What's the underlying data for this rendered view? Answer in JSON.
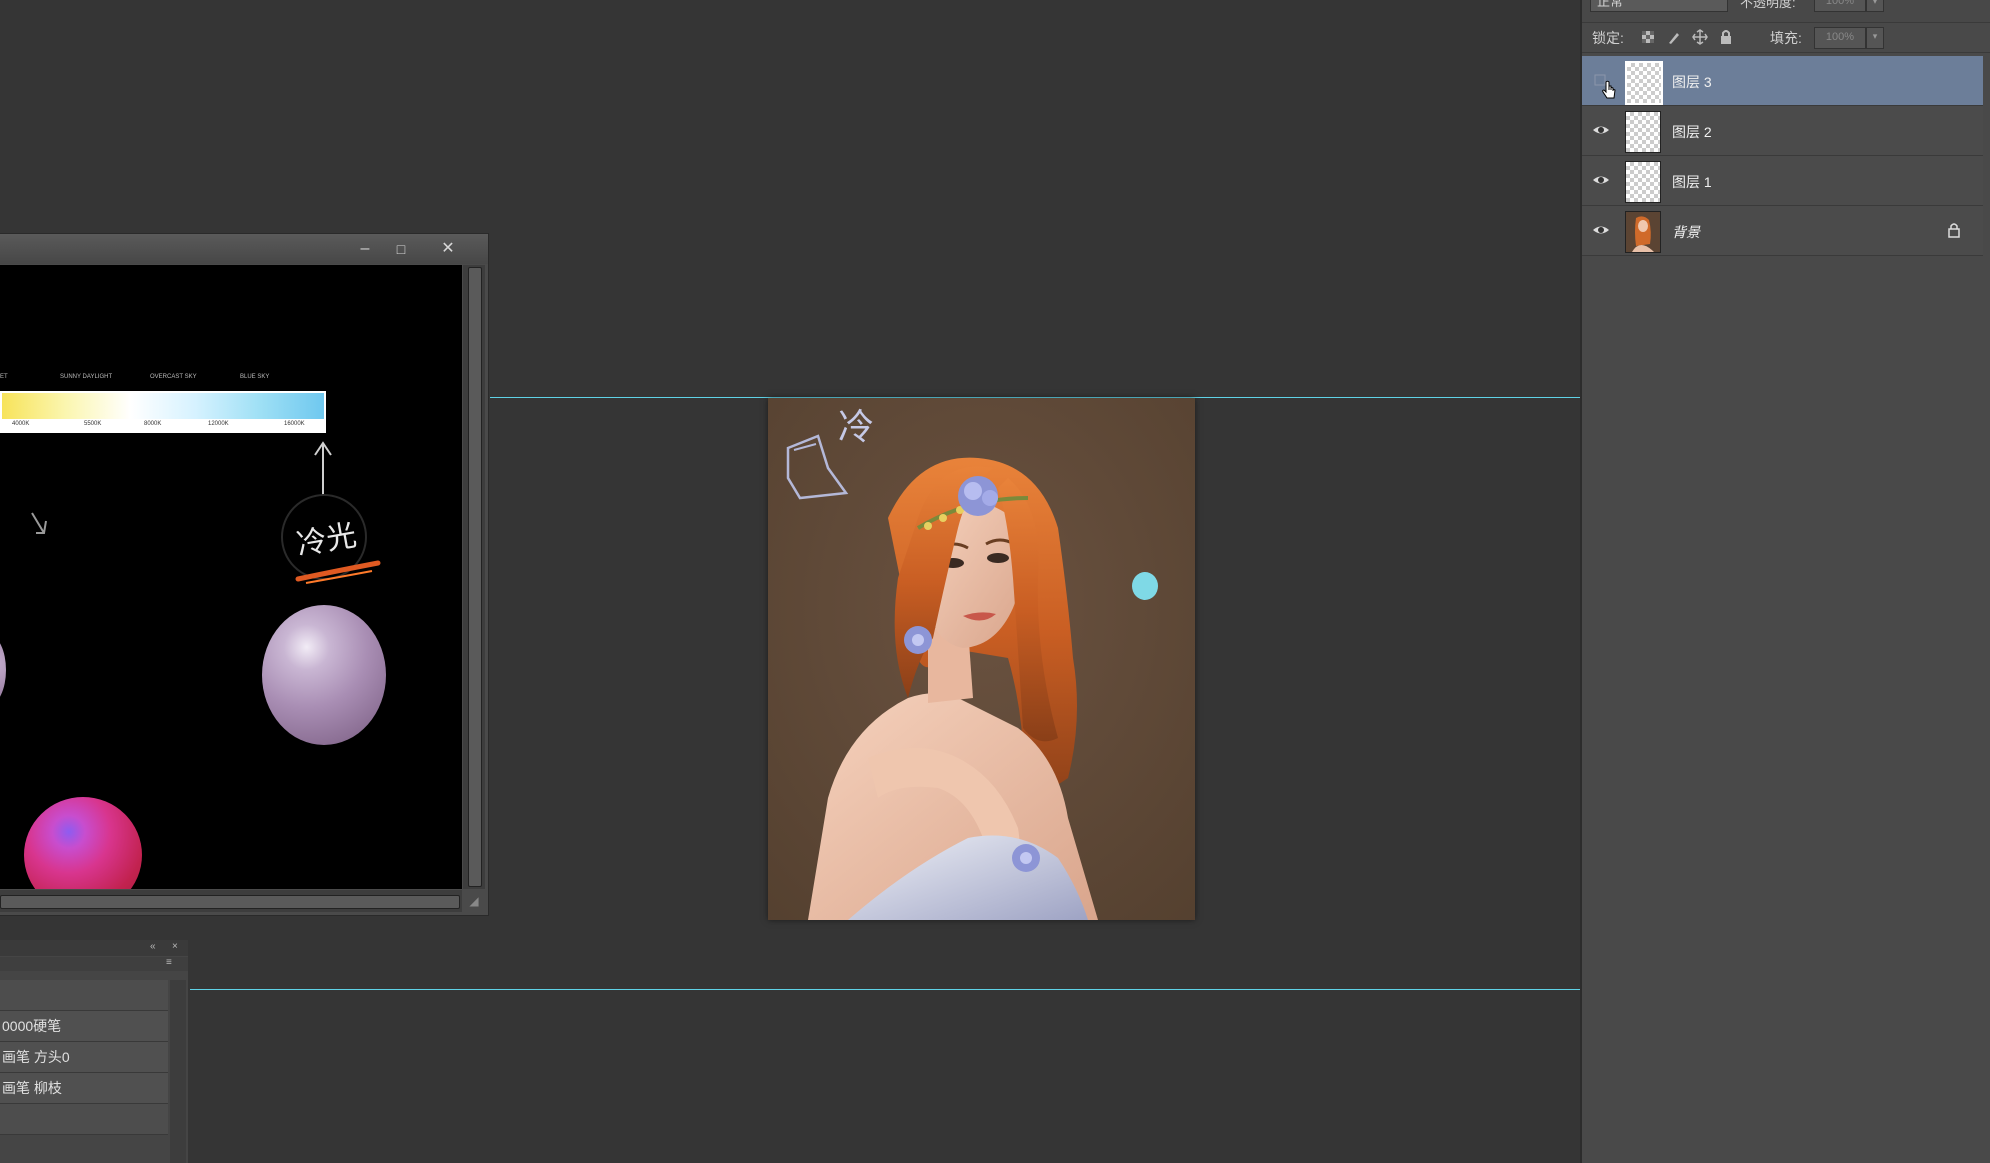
{
  "layers_panel": {
    "blend_mode": "正常",
    "opacity_label": "不透明度:",
    "opacity_value": "100%",
    "lock_label": "锁定:",
    "fill_label": "填充:",
    "fill_value": "100%",
    "layers": [
      {
        "name": "图层 3",
        "visible": false,
        "selected": true
      },
      {
        "name": "图层 2",
        "visible": true,
        "selected": false
      },
      {
        "name": "图层 1",
        "visible": true,
        "selected": false
      },
      {
        "name": "背景",
        "visible": true,
        "selected": false,
        "locked": true
      }
    ]
  },
  "reference_window": {
    "kelvin_labels": [
      "ET",
      "SUNNY DAYLIGHT",
      "OVERCAST SKY",
      "BLUE SKY"
    ],
    "kelvin_ticks": [
      "4000K",
      "5500K",
      "8000K",
      "12000K",
      "16000K"
    ],
    "sketch_text": "冷光"
  },
  "artwork": {
    "sketch_text": "冷"
  },
  "brush_panel": {
    "items": [
      "",
      "0000硬笔",
      "画笔 方头0",
      "画笔 柳枝"
    ]
  }
}
